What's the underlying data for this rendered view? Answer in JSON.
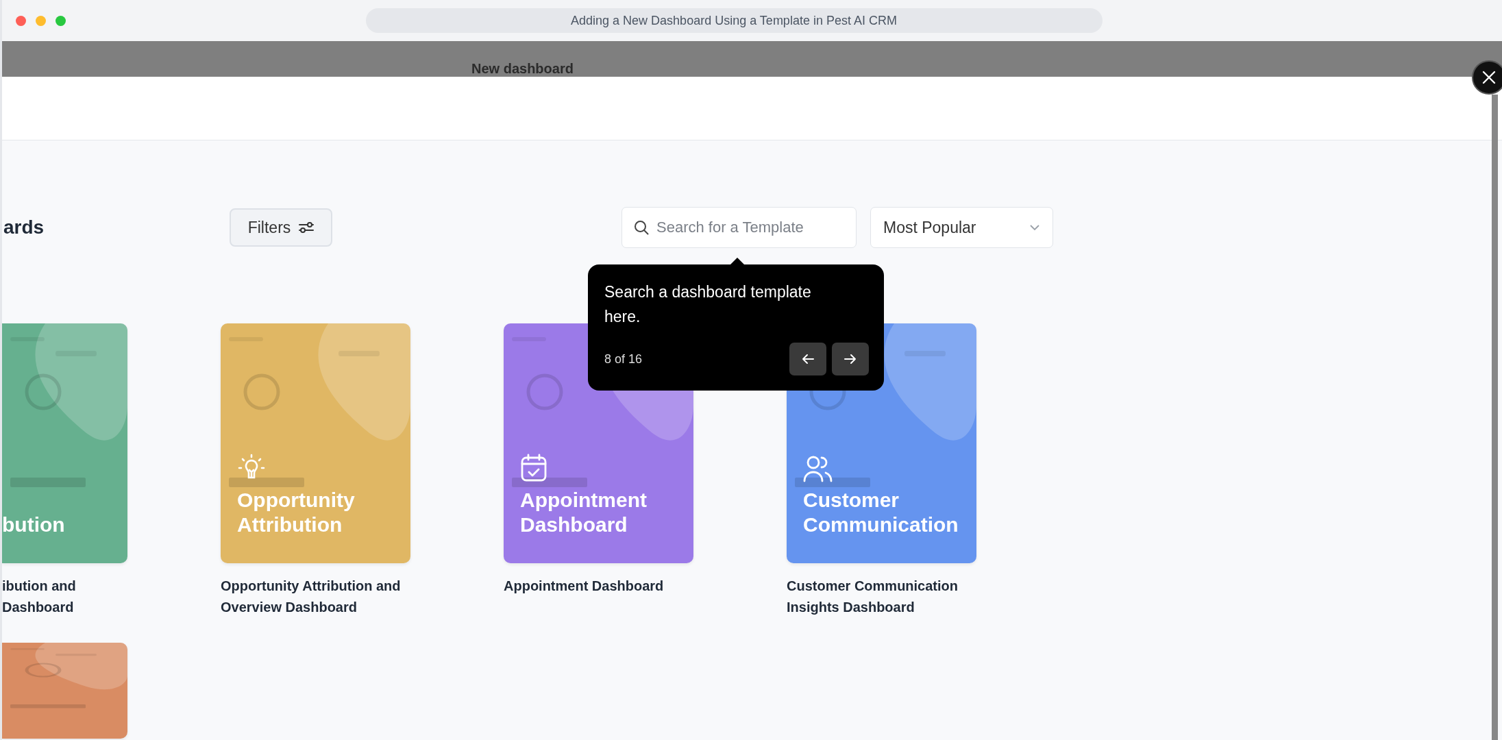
{
  "window": {
    "title": "Adding a New Dashboard Using a Template in Pest AI CRM"
  },
  "modal": {
    "title": "New dashboard"
  },
  "heading": "ards",
  "filters_button": {
    "label": "Filters"
  },
  "search": {
    "placeholder": "Search for a Template"
  },
  "sort": {
    "value": "Most Popular"
  },
  "tooltip": {
    "text": "Search a dashboard template here.",
    "step": "8 of 16"
  },
  "templates": [
    {
      "title": "bution",
      "caption": "ibution and Dashboard",
      "color": "#66b08f",
      "kind": "plain",
      "cropped": true
    },
    {
      "title": "Opportunity Attribution",
      "caption": "Opportunity Attribution and Overview Dashboard",
      "color": "#e0b764",
      "kind": "bulb",
      "cropped": false
    },
    {
      "title": "Appointment Dashboard",
      "caption": "Appointment Dashboard",
      "color": "#9b7ae8",
      "kind": "calendar",
      "cropped": false
    },
    {
      "title": "Customer Communication",
      "caption": "Customer Communication Insights Dashboard",
      "color": "#6594ef",
      "kind": "people",
      "cropped": false
    },
    {
      "color": "#d98c63",
      "kind": "plain",
      "cropped": true
    }
  ]
}
